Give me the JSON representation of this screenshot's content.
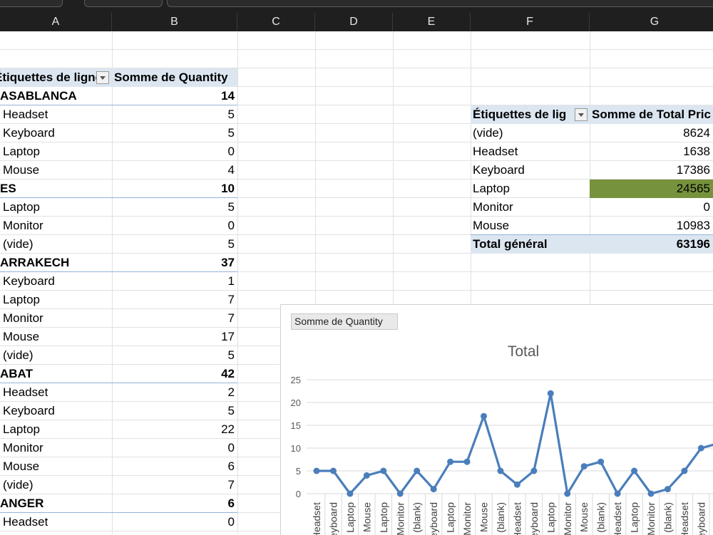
{
  "columns": [
    "A",
    "B",
    "C",
    "D",
    "E",
    "F",
    "G"
  ],
  "pivot1": {
    "header_label": "Étiquettes de lignes",
    "header_value": "Somme de Quantity",
    "rows": [
      {
        "label": "ASABLANCA",
        "value": "14",
        "group": true
      },
      {
        "label": "Headset",
        "value": "5",
        "group": false
      },
      {
        "label": "Keyboard",
        "value": "5",
        "group": false
      },
      {
        "label": "Laptop",
        "value": "0",
        "group": false
      },
      {
        "label": "Mouse",
        "value": "4",
        "group": false
      },
      {
        "label": "ES",
        "value": "10",
        "group": true
      },
      {
        "label": "Laptop",
        "value": "5",
        "group": false
      },
      {
        "label": "Monitor",
        "value": "0",
        "group": false
      },
      {
        "label": "(vide)",
        "value": "5",
        "group": false
      },
      {
        "label": "ARRAKECH",
        "value": "37",
        "group": true
      },
      {
        "label": "Keyboard",
        "value": "1",
        "group": false
      },
      {
        "label": "Laptop",
        "value": "7",
        "group": false
      },
      {
        "label": "Monitor",
        "value": "7",
        "group": false
      },
      {
        "label": "Mouse",
        "value": "17",
        "group": false
      },
      {
        "label": "(vide)",
        "value": "5",
        "group": false
      },
      {
        "label": "ABAT",
        "value": "42",
        "group": true
      },
      {
        "label": "Headset",
        "value": "2",
        "group": false
      },
      {
        "label": "Keyboard",
        "value": "5",
        "group": false
      },
      {
        "label": "Laptop",
        "value": "22",
        "group": false
      },
      {
        "label": "Monitor",
        "value": "0",
        "group": false
      },
      {
        "label": "Mouse",
        "value": "6",
        "group": false
      },
      {
        "label": "(vide)",
        "value": "7",
        "group": false
      },
      {
        "label": "ANGER",
        "value": "6",
        "group": true
      },
      {
        "label": "Headset",
        "value": "0",
        "group": false
      }
    ]
  },
  "pivot2": {
    "header_label": "Étiquettes de lig",
    "header_value": "Somme de Total Pric",
    "rows": [
      {
        "label": "(vide)",
        "value": "8624",
        "highlight": false
      },
      {
        "label": "Headset",
        "value": "1638",
        "highlight": false
      },
      {
        "label": "Keyboard",
        "value": "17386",
        "highlight": false
      },
      {
        "label": "Laptop",
        "value": "24565",
        "highlight": true
      },
      {
        "label": "Monitor",
        "value": "0",
        "highlight": false
      },
      {
        "label": "Mouse",
        "value": "10983",
        "highlight": false
      }
    ],
    "total_label": "Total général",
    "total_value": "63196"
  },
  "colors": {
    "highlight": "#76923c",
    "series": "#4a7ebb",
    "pivot_header": "#dce6f1"
  },
  "chart": {
    "field_button": "Somme de Quantity",
    "title": "Total"
  },
  "chart_data": {
    "type": "line",
    "title": "Total",
    "ylim": [
      0,
      25
    ],
    "yticks": [
      0,
      5,
      10,
      15,
      20,
      25
    ],
    "grid": true,
    "categories": [
      "Headset",
      "Keyboard",
      "Laptop",
      "Mouse",
      "Laptop",
      "Monitor",
      "(blank)",
      "Keyboard",
      "Laptop",
      "Monitor",
      "Mouse",
      "(blank)",
      "Headset",
      "Keyboard",
      "Laptop",
      "Monitor",
      "Mouse",
      "(blank)",
      "Headset",
      "Laptop",
      "Monitor",
      "(blank)",
      "Headset",
      "Keyboard"
    ],
    "series": [
      {
        "values": [
          5,
          5,
          0,
          4,
          5,
          0,
          5,
          1,
          7,
          7,
          17,
          5,
          2,
          5,
          22,
          0,
          6,
          7,
          0,
          5,
          0,
          1,
          5,
          10,
          11
        ]
      }
    ]
  }
}
